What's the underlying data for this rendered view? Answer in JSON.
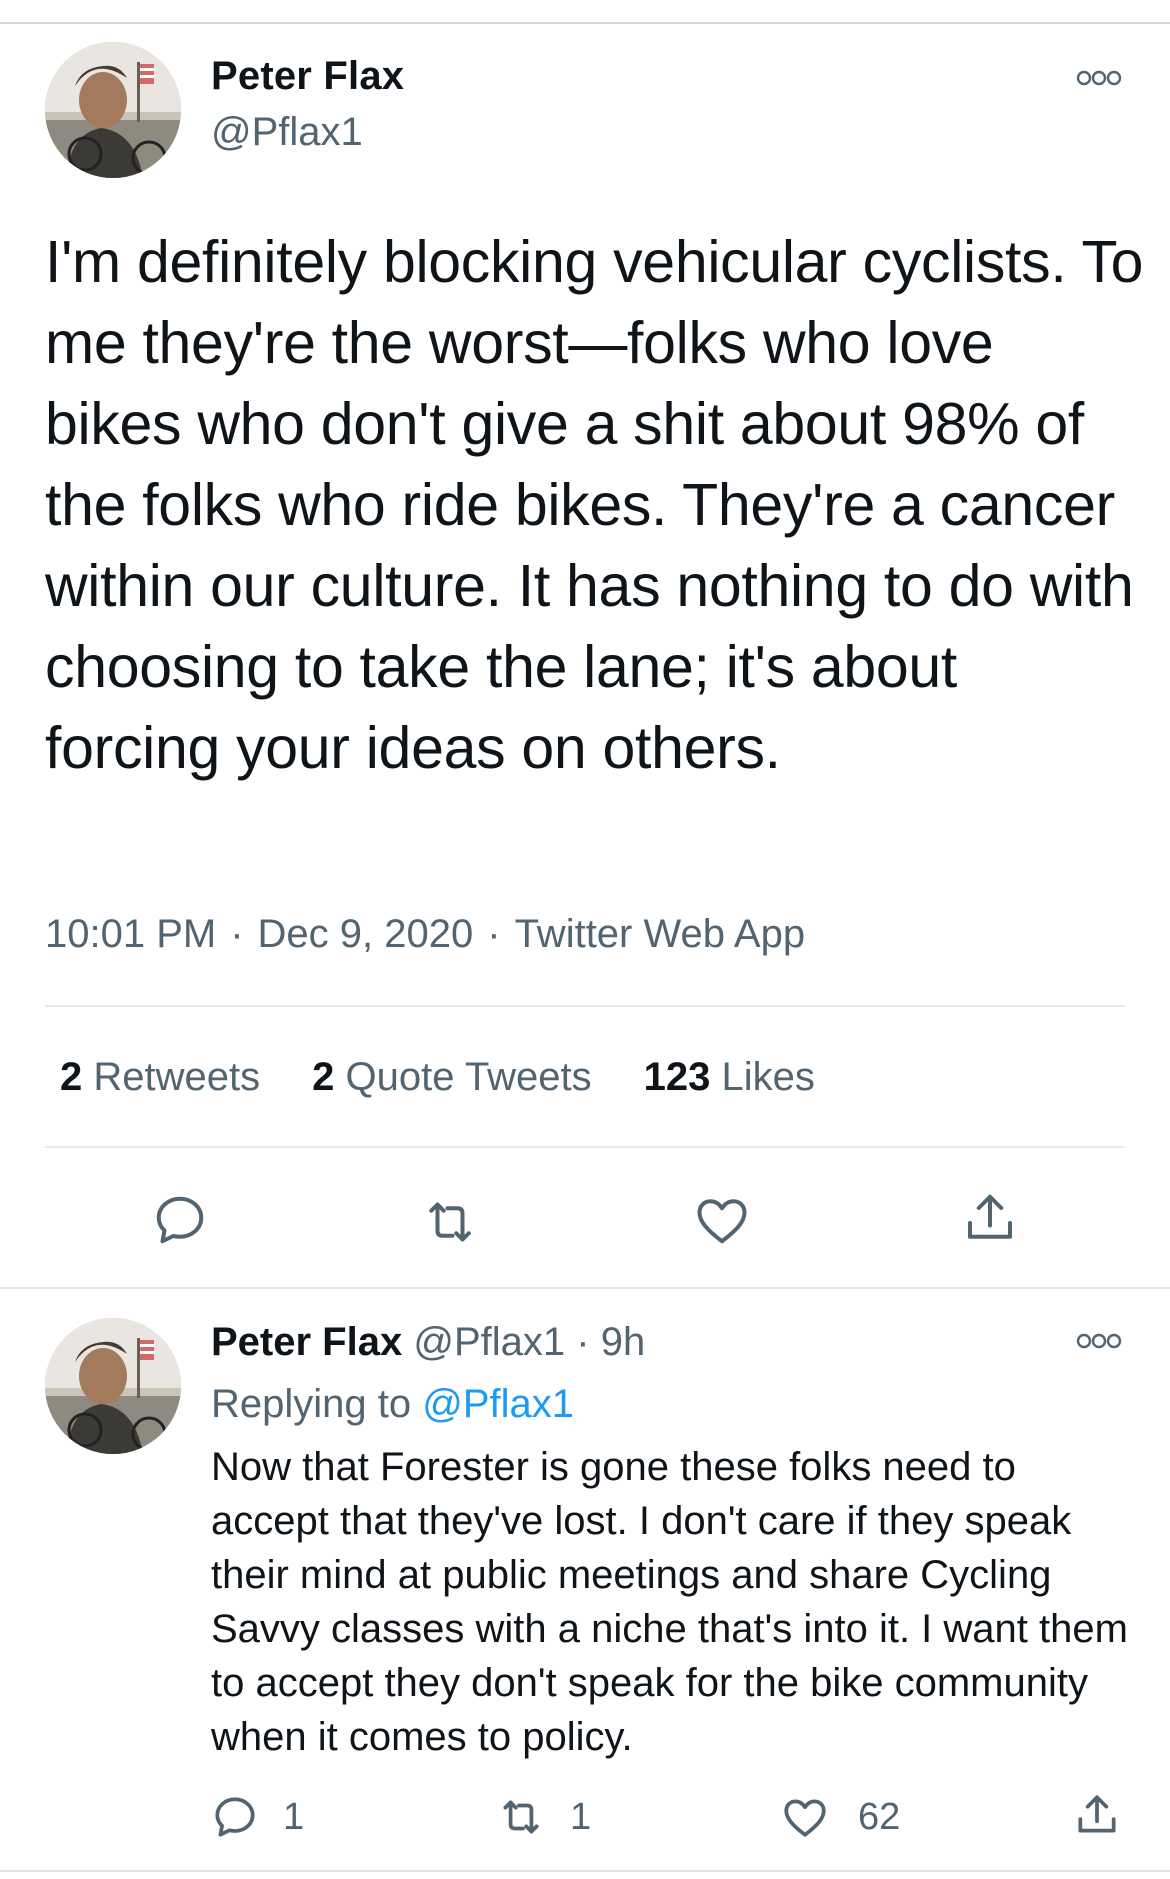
{
  "main_tweet": {
    "author_name": "Peter Flax",
    "handle": "@Pflax1",
    "text": "I'm definitely blocking vehicular cyclists. To me they're the worst—folks who love bikes who don't give a shit about 98% of the folks who ride bikes. They're a cancer within our culture. It has nothing to do with choosing to take the lane; it's about forcing your ideas on others.",
    "time": "10:01 PM",
    "separator": "·",
    "date": "Dec 9, 2020",
    "source": "Twitter Web App",
    "stats": {
      "retweets_count": "2",
      "retweets_label": "Retweets",
      "quotes_count": "2",
      "quotes_label": "Quote Tweets",
      "likes_count": "123",
      "likes_label": "Likes"
    },
    "actions": [
      "reply-icon",
      "retweet-icon",
      "like-icon",
      "share-icon"
    ]
  },
  "reply_tweet": {
    "author_name": "Peter Flax",
    "handle": "@Pflax1",
    "separator": "·",
    "time_ago": "9h",
    "replying_label": "Replying to",
    "replying_to": "@Pflax1",
    "text": "Now that Forester is gone these folks need to accept that they've lost. I don't care if they speak their mind at public meetings and share Cycling Savvy classes with a niche that's into it. I want them to accept they don't speak for the bike community when it comes to policy.",
    "reply_count": "1",
    "retweet_count": "1",
    "like_count": "62"
  },
  "colors": {
    "text": "#0f1419",
    "secondary": "#536471",
    "accent": "#1d9bf0",
    "divider": "#e4e9ec"
  }
}
